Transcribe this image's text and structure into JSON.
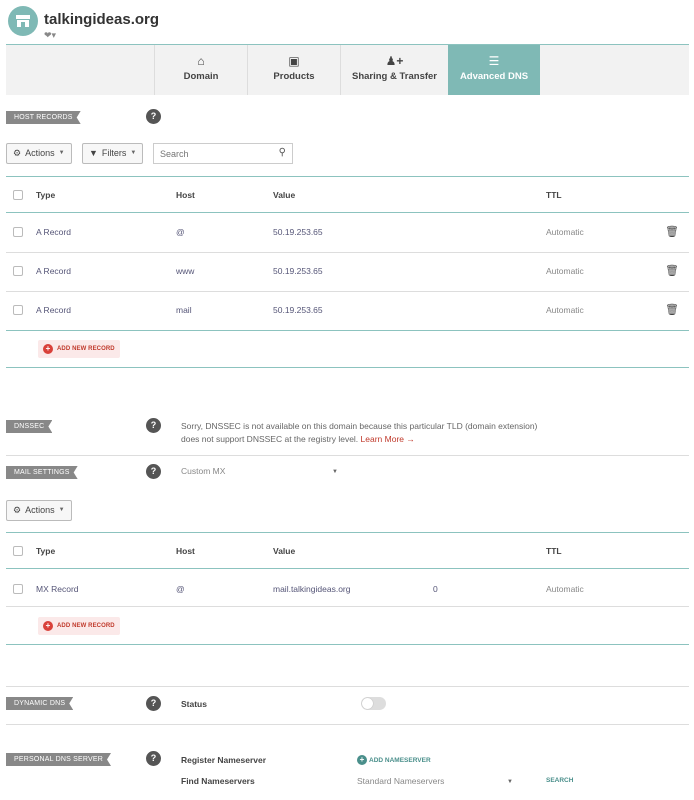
{
  "header": {
    "domain": "talkingideas.org",
    "sub_icon": "heart-icon"
  },
  "tabs": [
    {
      "label": "Domain",
      "icon": "home-icon"
    },
    {
      "label": "Products",
      "icon": "box-icon"
    },
    {
      "label": "Sharing & Transfer",
      "icon": "user-plus-icon"
    },
    {
      "label": "Advanced DNS",
      "icon": "server-icon",
      "active": true
    }
  ],
  "host_records": {
    "tag": "HOST RECORDS",
    "actions_label": "Actions",
    "filters_label": "Filters",
    "search_placeholder": "Search",
    "columns": {
      "type": "Type",
      "host": "Host",
      "value": "Value",
      "ttl": "TTL"
    },
    "rows": [
      {
        "type": "A Record",
        "host": "@",
        "value": "50.19.253.65",
        "ttl": "Automatic"
      },
      {
        "type": "A Record",
        "host": "www",
        "value": "50.19.253.65",
        "ttl": "Automatic"
      },
      {
        "type": "A Record",
        "host": "mail",
        "value": "50.19.253.65",
        "ttl": "Automatic"
      }
    ],
    "add_label": "ADD NEW RECORD"
  },
  "dnssec": {
    "tag": "DNSSEC",
    "text_line1": "Sorry, DNSSEC is not available on this domain because this particular TLD (domain extension)",
    "text_line2": "does not support DNSSEC at the registry level.",
    "learn_more": "Learn More →"
  },
  "mail_settings": {
    "tag": "MAIL SETTINGS",
    "selected": "Custom MX",
    "actions_label": "Actions",
    "columns": {
      "type": "Type",
      "host": "Host",
      "value": "Value",
      "ttl": "TTL"
    },
    "rows": [
      {
        "type": "MX Record",
        "host": "@",
        "value": "mail.talkingideas.org",
        "priority": "0",
        "ttl": "Automatic"
      }
    ],
    "add_label": "ADD NEW RECORD"
  },
  "dynamic_dns": {
    "tag": "DYNAMIC DNS",
    "status_label": "Status",
    "enabled": false
  },
  "personal_dns": {
    "tag": "PERSONAL DNS SERVER",
    "register_label": "Register Nameserver",
    "add_ns_label": "ADD NAMESERVER",
    "find_label": "Find Nameservers",
    "find_selected": "Standard Nameservers",
    "search_label": "SEARCH"
  },
  "colors": {
    "accent": "#7fb9b5",
    "danger": "#d9413a"
  }
}
